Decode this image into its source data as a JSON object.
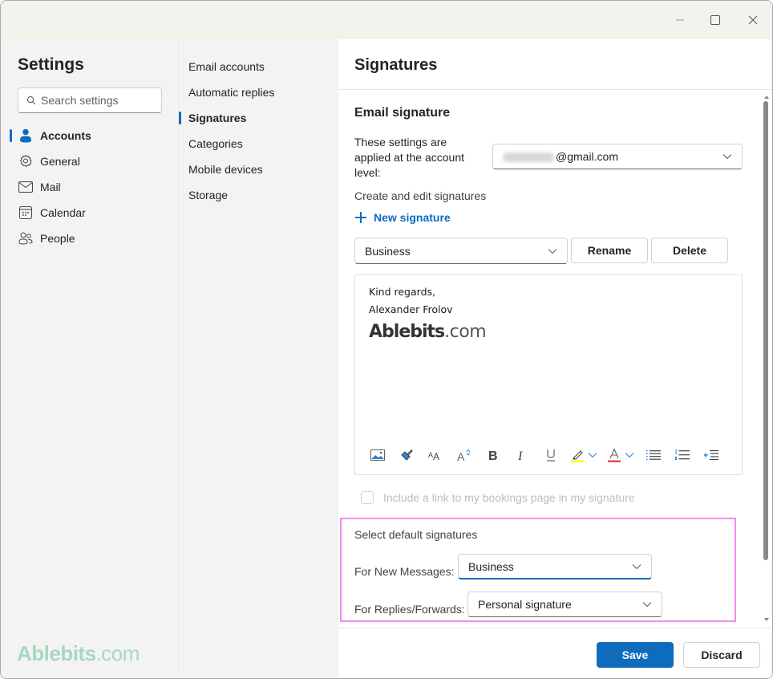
{
  "window": {
    "controls": {
      "minimize": "minimize",
      "maximize": "maximize",
      "close": "close"
    }
  },
  "settings": {
    "title": "Settings",
    "search_placeholder": "Search settings",
    "nav": [
      {
        "label": "Accounts",
        "icon": "person-icon",
        "active": true
      },
      {
        "label": "General",
        "icon": "gear-icon",
        "active": false
      },
      {
        "label": "Mail",
        "icon": "mail-icon",
        "active": false
      },
      {
        "label": "Calendar",
        "icon": "calendar-icon",
        "active": false
      },
      {
        "label": "People",
        "icon": "people-icon",
        "active": false
      }
    ],
    "watermark": {
      "brand": "Ablebits",
      "suffix": ".com"
    }
  },
  "accounts_nav": [
    {
      "label": "Email accounts",
      "active": false
    },
    {
      "label": "Automatic replies",
      "active": false
    },
    {
      "label": "Signatures",
      "active": true
    },
    {
      "label": "Categories",
      "active": false
    },
    {
      "label": "Mobile devices",
      "active": false
    },
    {
      "label": "Storage",
      "active": false
    }
  ],
  "main": {
    "title": "Signatures",
    "section_title": "Email signature",
    "account_label": "These settings are applied at the account level:",
    "account_value": "@gmail.com",
    "create_label": "Create and edit signatures",
    "new_signature_label": "New signature",
    "selected_signature": "Business",
    "rename_label": "Rename",
    "delete_label": "Delete",
    "editor": {
      "line1": "Kind regards,",
      "line2": "Alexander Frolov",
      "brand": "Ablebits",
      "brand_suffix": ".com"
    },
    "toolbar": [
      "insert-image-icon",
      "format-painter-icon",
      "font-size-icon",
      "grow-font-icon",
      "bold-icon",
      "italic-icon",
      "underline-icon",
      "highlight-icon",
      "font-color-icon",
      "bullets-icon",
      "numbering-icon",
      "decrease-indent-icon"
    ],
    "bookings_label": "Include a link to my bookings page in my signature",
    "bookings_checked": false,
    "defaults": {
      "title": "Select default signatures",
      "new_messages_label": "For New Messages:",
      "new_messages_value": "Business",
      "replies_label": "For Replies/Forwards:",
      "replies_value": "Personal signature"
    },
    "save_label": "Save",
    "discard_label": "Discard"
  },
  "colors": {
    "accent": "#0f6cbd",
    "highlight_box": "#f08cf0",
    "highlight_yellow": "#ffff00",
    "font_color_red": "#e05050"
  }
}
